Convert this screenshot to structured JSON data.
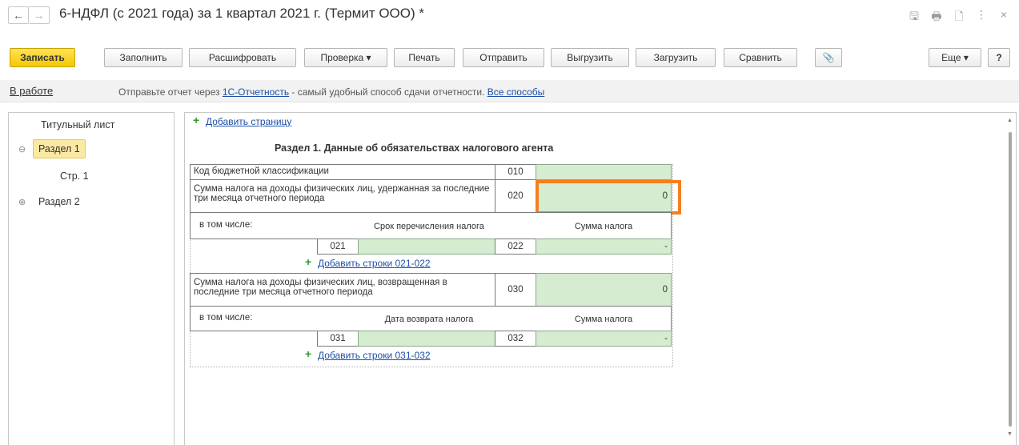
{
  "window": {
    "title": "6-НДФЛ (с 2021 года) за 1 квартал 2021 г. (Термит ООО) *",
    "back_icon": "←",
    "forward_icon": "→",
    "save_icon": "🖫",
    "print_icon": "🖶",
    "preview_icon": "🗋",
    "more_icon": "⋮",
    "close_icon": "×"
  },
  "toolbar": {
    "save": "Записать",
    "fill": "Заполнить",
    "decode": "Расшифровать",
    "check": "Проверка ▾",
    "print": "Печать",
    "send": "Отправить",
    "export": "Выгрузить",
    "import": "Загрузить",
    "compare": "Сравнить",
    "attach_icon": "📎",
    "more": "Еще ▾",
    "help": "?"
  },
  "status": {
    "state": "В работе",
    "msg_prefix": "Отправьте отчет через ",
    "msg_link": "1С-Отчетность",
    "msg_middle": " - самый удобный способ сдачи отчетности. ",
    "msg_link2": "Все способы"
  },
  "tree": {
    "title_page": "Титульный лист",
    "section1": "Раздел 1",
    "section1_toggle": "⊖",
    "page1": "Стр. 1",
    "section2": "Раздел 2",
    "section2_toggle": "⊕"
  },
  "report": {
    "add_page": "Добавить страницу",
    "section_title": "Раздел 1. Данные об обязательствах налогового агента",
    "row010_label": "Код бюджетной классификации",
    "row010_code": "010",
    "row010_value": "",
    "row020_label": "Сумма налога на доходы физических лиц, удержанная за последние три месяца отчетного периода",
    "row020_code": "020",
    "row020_value": "0",
    "incl1": "в том числе:",
    "term_header": "Срок перечисления налога",
    "sum_header1": "Сумма налога",
    "row021_code": "021",
    "row022_code": "022",
    "row022_value": "-",
    "add_rows_021": "Добавить строки 021-022",
    "row030_label": "Сумма налога на доходы физических лиц, возвращенная в последние три месяца отчетного периода",
    "row030_code": "030",
    "row030_value": "0",
    "incl2": "в том числе:",
    "return_header": "Дата возврата налога",
    "sum_header2": "Сумма налога",
    "row031_code": "031",
    "row032_code": "032",
    "row032_value": "-",
    "add_rows_031": "Добавить строки 031-032"
  },
  "colors": {
    "primary_button": "#f5c800",
    "green_cell": "#d6ecd1",
    "highlight": "#f57f20",
    "link": "#1b4fa8"
  }
}
